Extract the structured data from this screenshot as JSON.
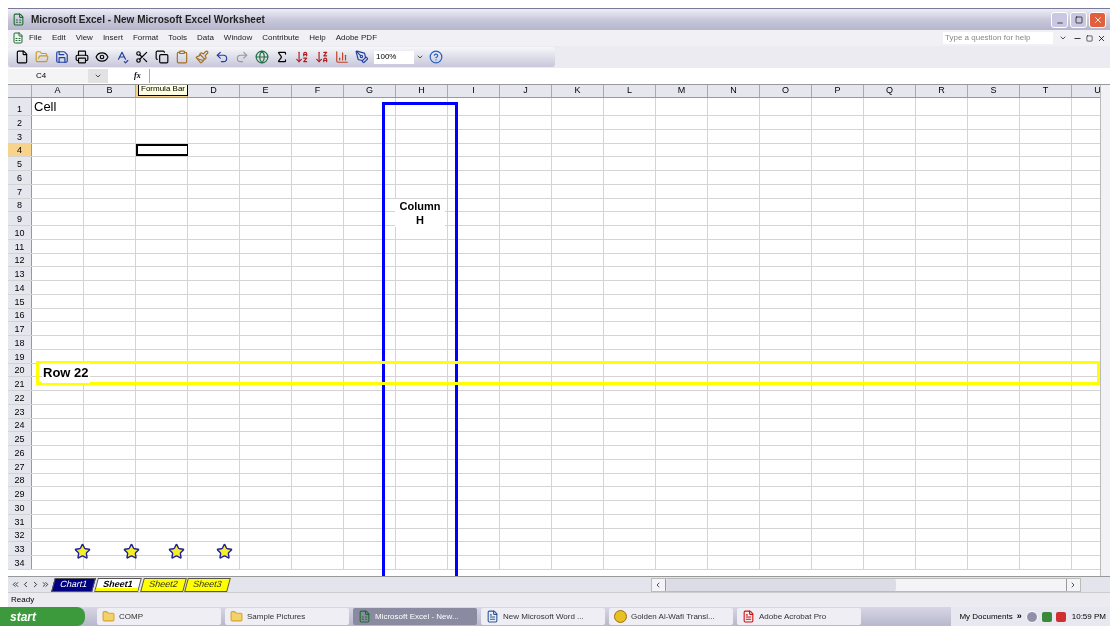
{
  "window": {
    "title": "Microsoft Excel - New Microsoft Excel Worksheet"
  },
  "menu": [
    "File",
    "Edit",
    "View",
    "Insert",
    "Format",
    "Tools",
    "Data",
    "Window",
    "Contribute",
    "Help",
    "Adobe PDF"
  ],
  "help_field": {
    "placeholder": "Type a question for help"
  },
  "toolbar": {
    "zoom": "100%"
  },
  "formula_bar": {
    "name_box": "C4",
    "fx": "fx"
  },
  "columns": [
    {
      "label": "A",
      "selected": false
    },
    {
      "label": "B",
      "selected": false
    },
    {
      "tooltip": "Formula Bar",
      "selected": true
    },
    {
      "label": "D",
      "selected": false
    },
    {
      "label": "E",
      "selected": false
    },
    {
      "label": "F",
      "selected": false
    },
    {
      "label": "G",
      "selected": false
    },
    {
      "label": "H",
      "selected": false
    },
    {
      "label": "I",
      "selected": false
    },
    {
      "label": "J",
      "selected": false
    },
    {
      "label": "K",
      "selected": false
    },
    {
      "label": "L",
      "selected": false
    },
    {
      "label": "M",
      "selected": false
    },
    {
      "label": "N",
      "selected": false
    },
    {
      "label": "O",
      "selected": false
    },
    {
      "label": "P",
      "selected": false
    },
    {
      "label": "Q",
      "selected": false
    },
    {
      "label": "R",
      "selected": false
    },
    {
      "label": "S",
      "selected": false
    },
    {
      "label": "T",
      "selected": false
    },
    {
      "label": "U",
      "selected": false
    }
  ],
  "rows": [
    {
      "label": "1",
      "selected": false,
      "cells": [
        "Cell"
      ]
    },
    {
      "label": "2",
      "selected": false
    },
    {
      "label": "3",
      "selected": false
    },
    {
      "label": "4",
      "selected": true
    },
    {
      "label": "5",
      "selected": false
    },
    {
      "label": "6",
      "selected": false
    },
    {
      "label": "7",
      "selected": false
    },
    {
      "label": "8",
      "selected": false
    },
    {
      "label": "9",
      "selected": false
    },
    {
      "label": "10",
      "selected": false
    },
    {
      "label": "11",
      "selected": false
    },
    {
      "label": "12",
      "selected": false
    },
    {
      "label": "13",
      "selected": false
    },
    {
      "label": "14",
      "selected": false
    },
    {
      "label": "15",
      "selected": false
    },
    {
      "label": "16",
      "selected": false
    },
    {
      "label": "17",
      "selected": false
    },
    {
      "label": "18",
      "selected": false
    },
    {
      "label": "19",
      "selected": false
    },
    {
      "label": "20",
      "selected": false
    },
    {
      "label": "21",
      "selected": false
    },
    {
      "label": "22",
      "selected": false
    },
    {
      "label": "23",
      "selected": false
    },
    {
      "label": "24",
      "selected": false
    },
    {
      "label": "25",
      "selected": false
    },
    {
      "label": "26",
      "selected": false
    },
    {
      "label": "27",
      "selected": false
    },
    {
      "label": "28",
      "selected": false
    },
    {
      "label": "29",
      "selected": false
    },
    {
      "label": "30",
      "selected": false
    },
    {
      "label": "31",
      "selected": false
    },
    {
      "label": "32",
      "selected": false
    },
    {
      "label": "33",
      "selected": false
    },
    {
      "label": "34",
      "selected": false
    }
  ],
  "annotations": [
    {
      "kind": "column_box",
      "text": "Column H",
      "color": "#0000ff"
    },
    {
      "kind": "row_box",
      "text": "Row 22",
      "color": "#ffff00"
    }
  ],
  "sheet_tabs": [
    {
      "label": "Chart1",
      "selected": false,
      "color": "#000080"
    },
    {
      "label": "Sheet1",
      "selected": true,
      "color": "#ffff00"
    },
    {
      "label": "Sheet2",
      "selected": false,
      "color": "#ffff00"
    },
    {
      "label": "Sheet3",
      "selected": false,
      "color": "#ffff00"
    }
  ],
  "status_bar": {
    "text": "Ready"
  },
  "taskbar": {
    "start": "start",
    "tasks": [
      {
        "label": "COMP",
        "kind": "folder",
        "selected": false
      },
      {
        "label": "Sample Pictures",
        "kind": "folder",
        "selected": false
      },
      {
        "label": "Microsoft Excel - New...",
        "kind": "excel",
        "selected": true
      },
      {
        "label": "New Microsoft Word ...",
        "kind": "word",
        "selected": false
      },
      {
        "label": "Golden Al-Wafi Transl...",
        "kind": "app",
        "selected": false
      },
      {
        "label": "Adobe Acrobat Pro",
        "kind": "pdf",
        "selected": false
      }
    ],
    "tray_toolbar": "My Documents",
    "tray_more": "»",
    "clock": "10:59 PM"
  }
}
